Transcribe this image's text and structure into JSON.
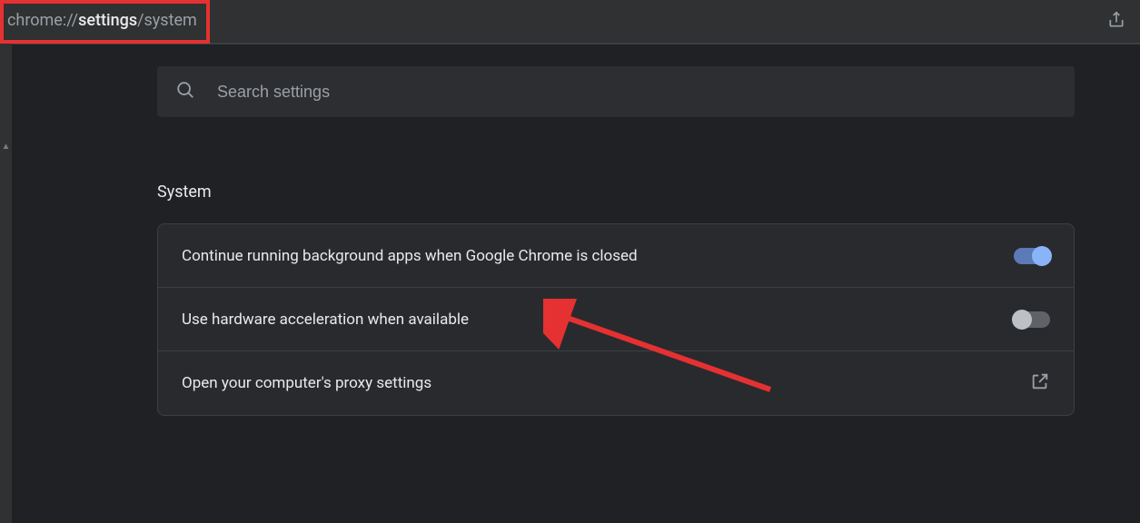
{
  "address": {
    "protocol": "chrome://",
    "path_bold": "settings",
    "path_rest": "/system"
  },
  "search": {
    "placeholder": "Search settings"
  },
  "section": {
    "title": "System",
    "rows": [
      {
        "label": "Continue running background apps when Google Chrome is closed",
        "control": "toggle",
        "state": "on"
      },
      {
        "label": "Use hardware acceleration when available",
        "control": "toggle",
        "state": "off"
      },
      {
        "label": "Open your computer's proxy settings",
        "control": "external"
      }
    ]
  },
  "colors": {
    "annotation": "#e53131",
    "toggle_on_track": "#5a7bb8",
    "toggle_on_knob": "#8ab4f8"
  }
}
